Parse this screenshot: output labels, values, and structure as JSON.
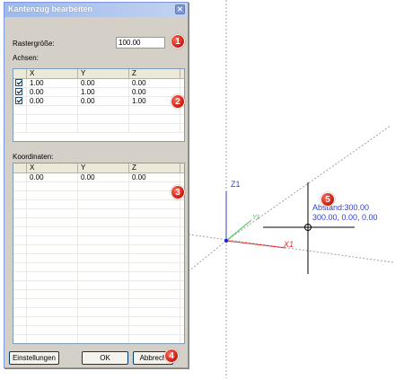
{
  "dialog": {
    "title": "Kantenzug bearbeiten",
    "close_glyph": "✕",
    "raster_label": "Rastergröße:",
    "raster_value": "100.00",
    "axes_label": "Achsen:",
    "coords_label": "Koordinaten:"
  },
  "axes_table": {
    "headers": [
      "",
      "X",
      "Y",
      "Z"
    ],
    "rows": [
      [
        "1.00",
        "0.00",
        "0.00"
      ],
      [
        "0.00",
        "1.00",
        "0.00"
      ],
      [
        "0.00",
        "0.00",
        "1.00"
      ]
    ]
  },
  "coords_table": {
    "headers": [
      "",
      "X",
      "Y",
      "Z"
    ],
    "rows": [
      [
        "0.00",
        "0.00",
        "0.00"
      ]
    ]
  },
  "buttons": {
    "settings": "Einstellungen",
    "ok": "OK",
    "cancel": "Abbrech"
  },
  "badges": [
    "1",
    "2",
    "3",
    "4",
    "5"
  ],
  "viewport": {
    "z_axis_label": "Z1",
    "y_axis_label": "Y1",
    "x_axis_label": "X1",
    "distance_text": "Abstand:300.00",
    "coord_text": "300.00, 0.00, 0.00"
  },
  "colors": {
    "z_axis": "#2d3fd2",
    "y_axis": "#2ecc40",
    "x_axis": "#e03030",
    "badge": "#d32010",
    "annotation_text": "#2d3fd2"
  }
}
